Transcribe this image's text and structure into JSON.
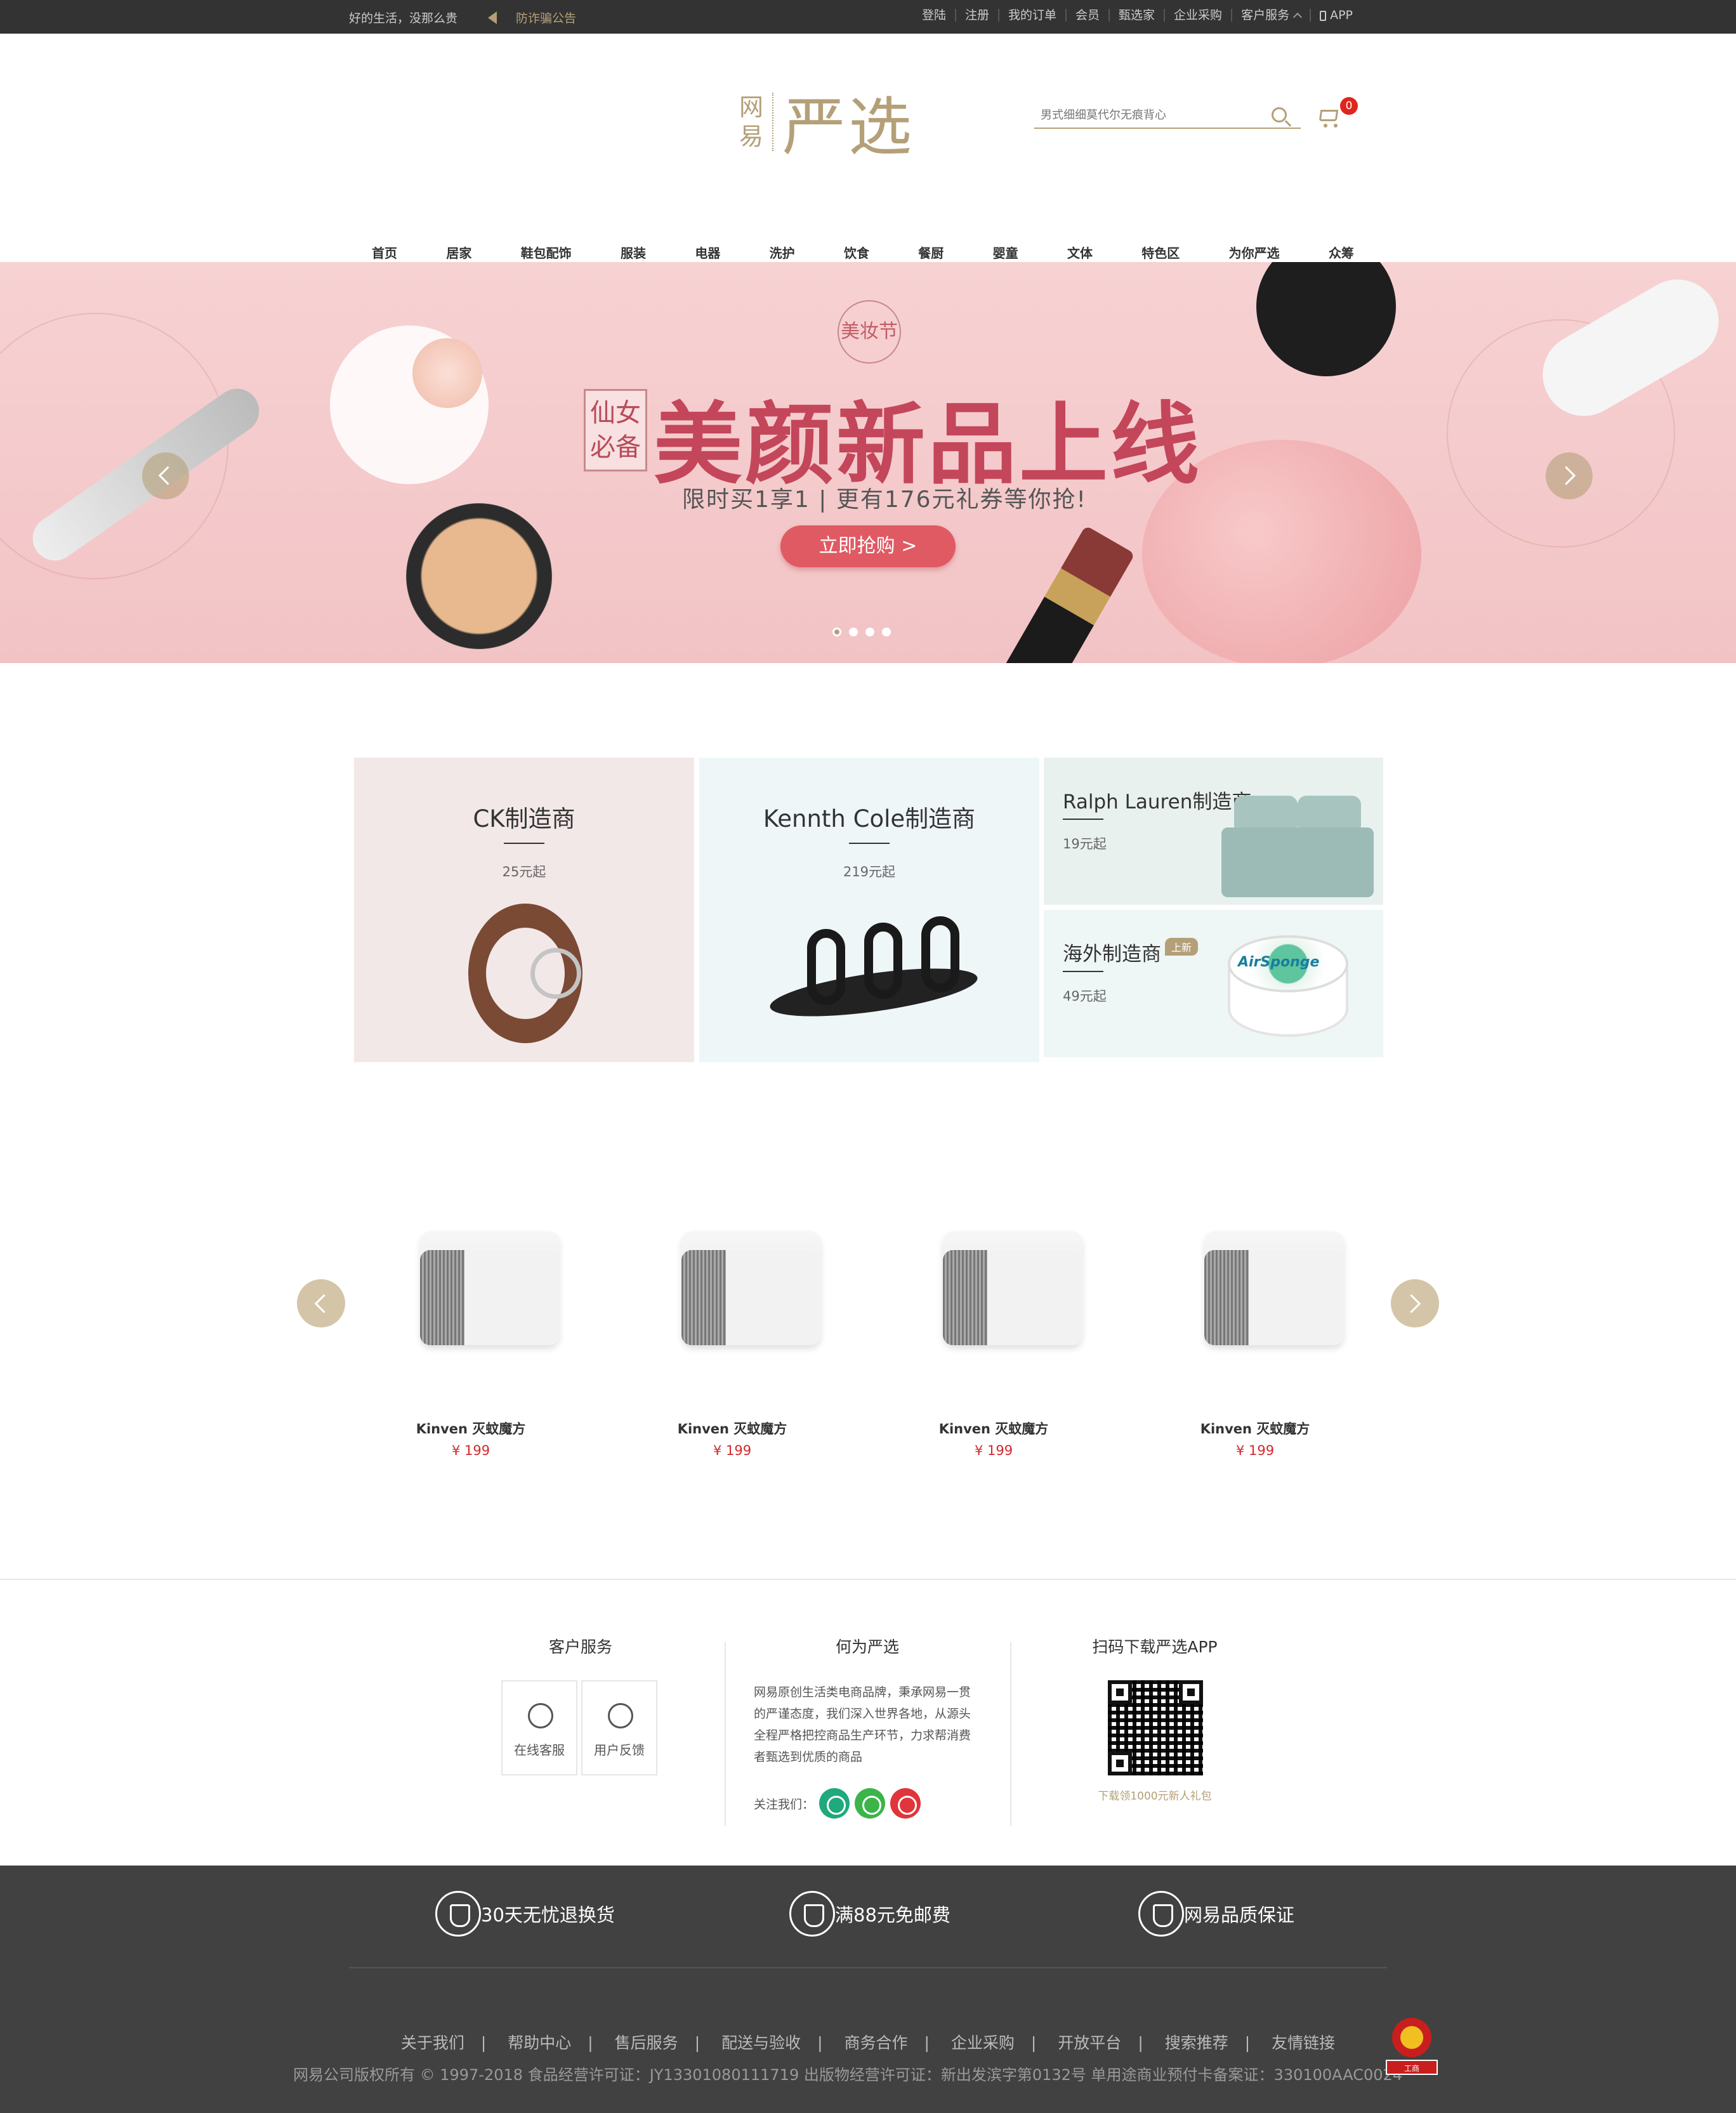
{
  "topbar": {
    "slogan": "好的生活，没那么贵",
    "notice": "防诈骗公告",
    "links": [
      "登陆",
      "注册",
      "我的订单",
      "会员",
      "甄选家",
      "企业采购",
      "客户服务"
    ],
    "app": "APP"
  },
  "header": {
    "logo_small_1": "网",
    "logo_small_2": "易",
    "logo_big": "严选",
    "search_placeholder": "男式细细莫代尔无痕背心",
    "cart_count": "0"
  },
  "nav": {
    "items": [
      "首页",
      "居家",
      "鞋包配饰",
      "服装",
      "电器",
      "洗护",
      "饮食",
      "餐厨",
      "婴童",
      "文体",
      "特色区",
      "为你严选",
      "众筹"
    ],
    "active_index": 0
  },
  "banner": {
    "seal": "美妆节",
    "tag_line1": "仙女",
    "tag_line2": "必备",
    "title": "美颜新品上线",
    "subtitle": "限时买1享1 | 更有176元礼券等你抢!",
    "button": "立即抢购 >",
    "slide_count": 4,
    "active_slide": 0
  },
  "brands": [
    {
      "name": "CK制造商",
      "price": "25元起"
    },
    {
      "name": "Kennth Cole制造商",
      "price": "219元起"
    },
    {
      "name": "Ralph Lauren制造商",
      "price": "19元起"
    },
    {
      "name": "海外制造商",
      "badge": "上新",
      "price": "49元起",
      "product_label": "AirSponge"
    }
  ],
  "products": [
    {
      "name": "Kinven 灭蚊魔方",
      "price": "¥ 199"
    },
    {
      "name": "Kinven 灭蚊魔方",
      "price": "¥ 199"
    },
    {
      "name": "Kinven 灭蚊魔方",
      "price": "¥ 199"
    },
    {
      "name": "Kinven 灭蚊魔方",
      "price": "¥ 199"
    }
  ],
  "footer": {
    "service_title": "客户服务",
    "service_online": "在线客服",
    "service_feedback": "用户反馈",
    "about_title": "何为严选",
    "about_text": "网易原创生活类电商品牌，秉承网易一贯的严谨态度，我们深入世界各地，从源头全程严格把控商品生产环节，力求帮消费者甄选到优质的商品",
    "follow_label": "关注我们：",
    "social_colors": [
      "#1fa97c",
      "#3cb44a",
      "#e0353a"
    ],
    "app_title": "扫码下载严选APP",
    "qr_caption": "下载领1000元新人礼包",
    "promises": [
      "30天无忧退换货",
      "满88元免邮费",
      "网易品质保证"
    ],
    "links": [
      "关于我们",
      "帮助中心",
      "售后服务",
      "配送与验收",
      "商务合作",
      "企业采购",
      "开放平台",
      "搜索推荐",
      "友情链接"
    ],
    "copyright": "网易公司版权所有 © 1997-2018 食品经营许可证：JY13301080111719 出版物经营许可证：新出发滨字第0132号 单用途商业预付卡备案证：330100AAC0024",
    "gov_badge": "工商"
  }
}
